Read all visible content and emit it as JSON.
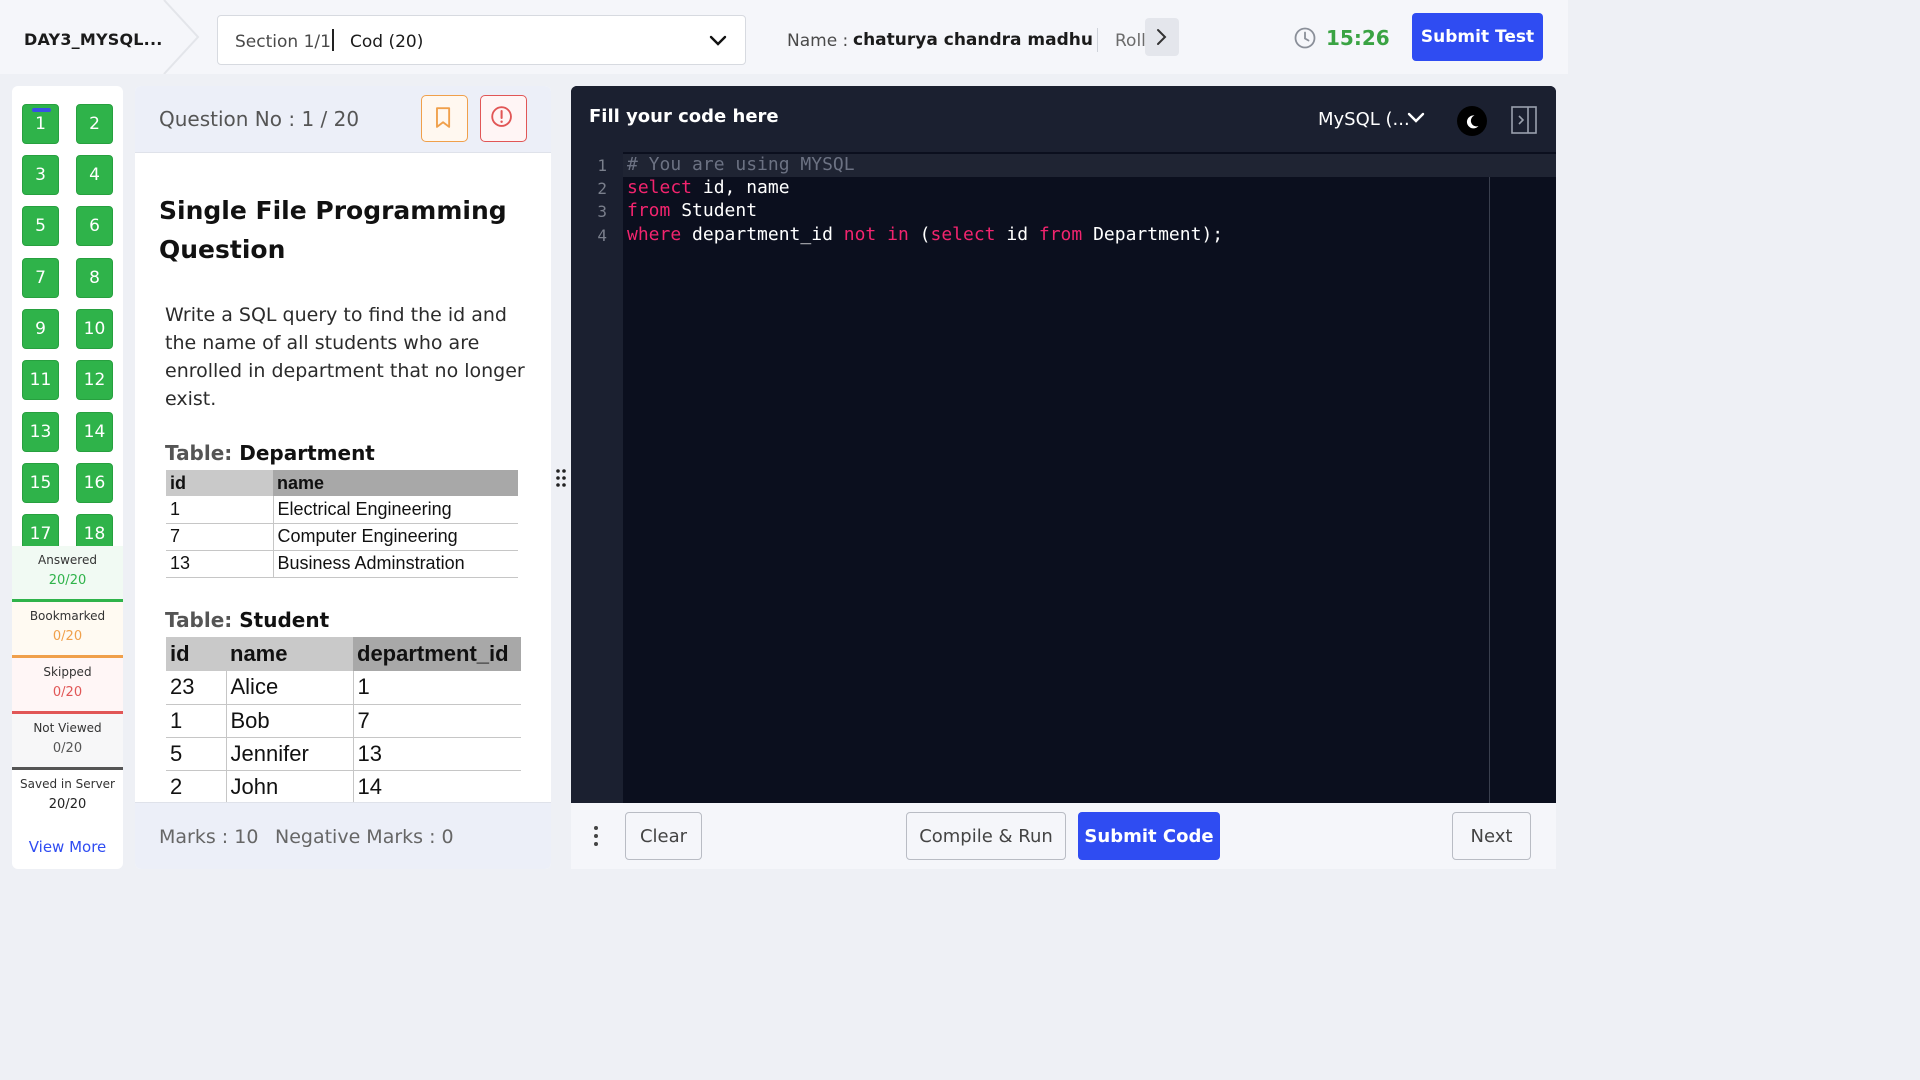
{
  "header": {
    "test_name": "DAY3_MYSQL...",
    "section_label": "Section 1/1",
    "section_selected": "Cod (20)",
    "candidate_label": "Name :",
    "candidate_name": "chaturya chandra madhu",
    "roll_label": "Roll",
    "timer": "15:26",
    "submit_test_label": "Submit Test"
  },
  "palette": {
    "questions": [
      "1",
      "2",
      "3",
      "4",
      "5",
      "6",
      "7",
      "8",
      "9",
      "10",
      "11",
      "12",
      "13",
      "14",
      "15",
      "16",
      "17",
      "18"
    ],
    "current": "1",
    "stats": [
      {
        "label": "Answered",
        "value": "20/20",
        "color": "#2fb34a"
      },
      {
        "label": "Bookmarked",
        "value": "0/20",
        "color": "#f0a04b"
      },
      {
        "label": "Skipped",
        "value": "0/20",
        "color": "#e15656"
      },
      {
        "label": "Not Viewed",
        "value": "0/20",
        "color": "#555555"
      },
      {
        "label": "Saved in Server",
        "value": "20/20",
        "color": "#222222"
      }
    ],
    "view_more": "View More"
  },
  "question": {
    "number_label": "Question No : 1 / 20",
    "title": "Single File Programming Question",
    "text": "Write a SQL query to find the id and the name of all students who are enrolled in department that no longer exist.",
    "department_table": {
      "caption_prefix": "Table:",
      "caption_name": "Department",
      "headers": [
        "id",
        "name"
      ],
      "rows": [
        [
          "1",
          "Electrical Engineering"
        ],
        [
          "7",
          "Computer Engineering"
        ],
        [
          "13",
          "Business Adminstration"
        ]
      ]
    },
    "student_table": {
      "caption_prefix": "Table:",
      "caption_name": "Student",
      "headers": [
        "id",
        "name",
        "department_id"
      ],
      "rows": [
        [
          "23",
          "Alice",
          "1"
        ],
        [
          "1",
          "Bob",
          "7"
        ],
        [
          "5",
          "Jennifer",
          "13"
        ],
        [
          "2",
          "John",
          "14"
        ]
      ]
    },
    "marks": "Marks : 10",
    "negative_marks": "Negative Marks : 0"
  },
  "editor": {
    "title": "Fill your code here",
    "language": "MySQL (...",
    "line_numbers": [
      "1",
      "2",
      "3",
      "4"
    ],
    "code": {
      "l1": "# You are using MYSQL",
      "l2_kw": "select",
      "l2_rest": " id, name",
      "l3_kw": "from",
      "l3_rest": " Student",
      "l4_a": "where",
      "l4_b": " department_id ",
      "l4_c": "not",
      "l4_d": " ",
      "l4_e": "in",
      "l4_f": " (",
      "l4_g": "select",
      "l4_h": " id ",
      "l4_i": "from",
      "l4_j": " Department);"
    },
    "keyword_color": "#f2246e"
  },
  "toolbar": {
    "clear_label": "Clear",
    "compile_label": "Compile & Run",
    "submit_code_label": "Submit Code",
    "next_label": "Next"
  },
  "colors": {
    "accent": "#2f4cf2",
    "answered": "#2fb34a",
    "timer": "#3aa343"
  }
}
